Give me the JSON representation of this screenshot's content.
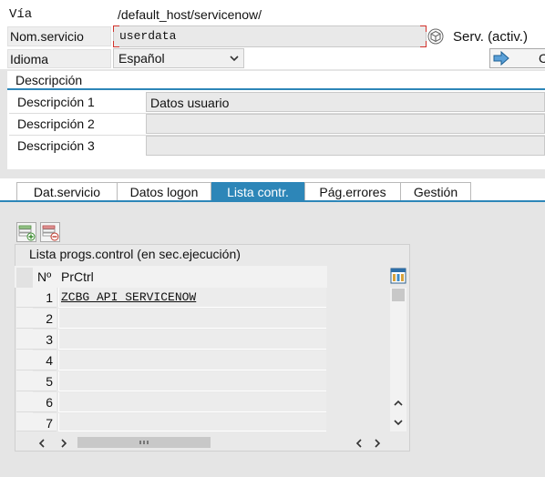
{
  "header": {
    "via_label": "Vía",
    "via_value": "/default_host/servicenow/",
    "service_label": "Nom.servicio",
    "service_value": "userdata",
    "serv_status": "Serv. (activ.)",
    "language_label": "Idioma",
    "language_value": "Español",
    "right_button_label": "C"
  },
  "description": {
    "title": "Descripción",
    "rows": [
      {
        "label": "Descripción 1",
        "value": "Datos usuario"
      },
      {
        "label": "Descripción 2",
        "value": ""
      },
      {
        "label": "Descripción 3",
        "value": ""
      }
    ]
  },
  "tabs": [
    {
      "label": "Dat.servicio",
      "active": false
    },
    {
      "label": "Datos logon",
      "active": false
    },
    {
      "label": "Lista contr.",
      "active": true
    },
    {
      "label": "Pág.errores",
      "active": false
    },
    {
      "label": "Gestión",
      "active": false
    }
  ],
  "table": {
    "title": "Lista progs.control (en sec.ejecución)",
    "col_number": "Nº",
    "col_prctrl": "PrCtrl",
    "rows": [
      {
        "n": "1",
        "value": "ZCBG_API_SERVICENOW"
      },
      {
        "n": "2",
        "value": ""
      },
      {
        "n": "3",
        "value": ""
      },
      {
        "n": "4",
        "value": ""
      },
      {
        "n": "5",
        "value": ""
      },
      {
        "n": "6",
        "value": ""
      },
      {
        "n": "7",
        "value": ""
      }
    ]
  },
  "colors": {
    "accent": "#2d86b8",
    "required": "#d2312b"
  }
}
